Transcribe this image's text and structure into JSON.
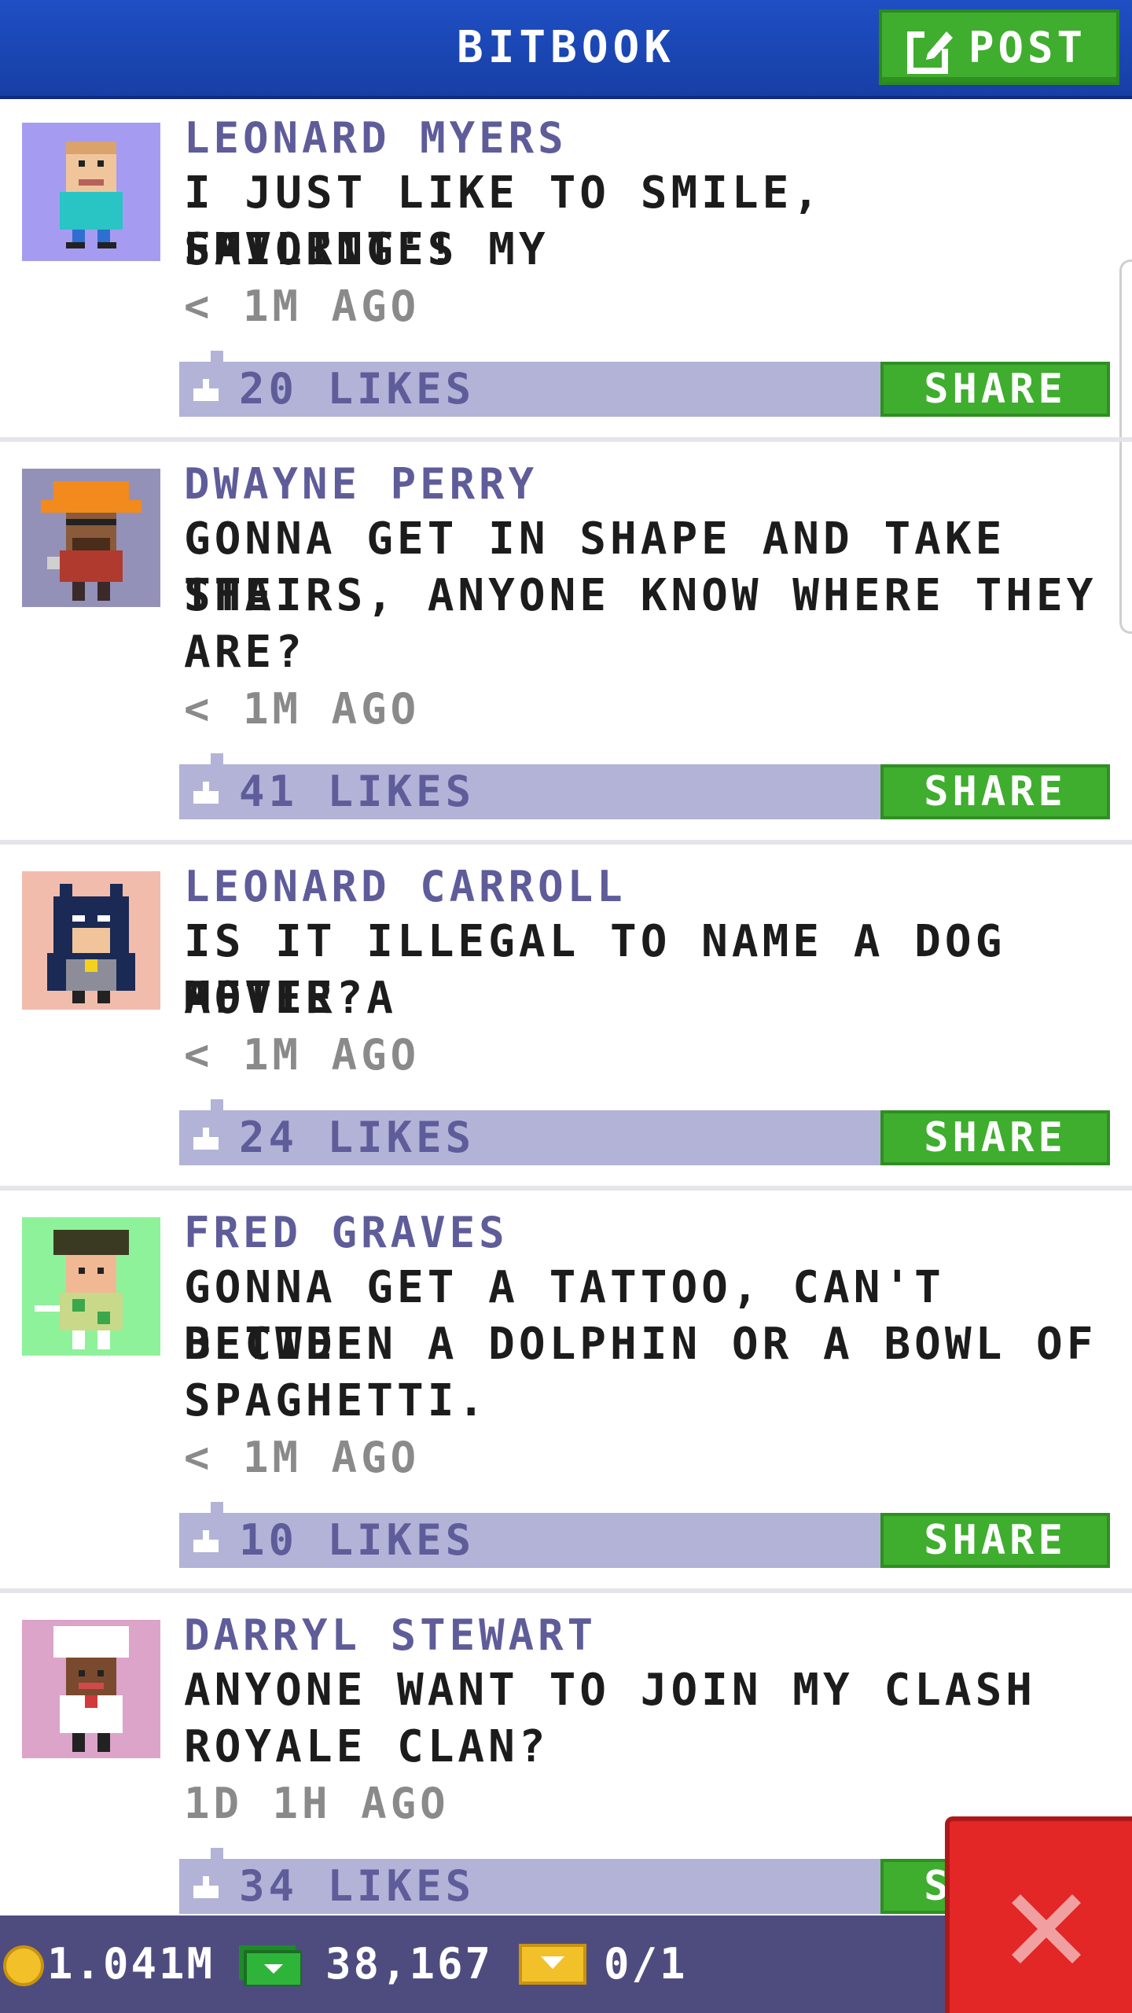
{
  "header": {
    "title": "BITBOOK",
    "post_label": "POST"
  },
  "colors": {
    "header_blue": "#1f4fc4",
    "action_green": "#3fad2e",
    "like_bar": "#b3b3d8",
    "name_purple": "#5f5c9a",
    "close_red": "#e32626"
  },
  "posts": [
    {
      "name": "LEONARD MYERS",
      "text_lines": [
        "I JUST LIKE TO SMILE, SMILING'S MY",
        "FAVORITE!"
      ],
      "time": "< 1M AGO",
      "likes": "20 LIKES",
      "share_label": "SHARE",
      "avatar_bg": "#a59cf2"
    },
    {
      "name": "DWAYNE PERRY",
      "text_lines": [
        "GONNA GET IN SHAPE AND TAKE THE",
        "STAIRS, ANYONE KNOW WHERE THEY",
        "ARE?"
      ],
      "time": "< 1M AGO",
      "likes": "41 LIKES",
      "share_label": "SHARE",
      "avatar_bg": "#9491b8"
    },
    {
      "name": "LEONARD CARROLL",
      "text_lines": [
        "IS IT ILLEGAL TO NAME A DOG AFTER A",
        "MOVIE?"
      ],
      "time": "< 1M AGO",
      "likes": "24 LIKES",
      "share_label": "SHARE",
      "avatar_bg": "#f2bcad"
    },
    {
      "name": "FRED GRAVES",
      "text_lines": [
        "GONNA GET A TATTOO, CAN'T DECIDE",
        "BETWEEN A DOLPHIN OR A BOWL OF",
        "SPAGHETTI."
      ],
      "time": "< 1M AGO",
      "likes": "10 LIKES",
      "share_label": "SHARE",
      "avatar_bg": "#8ef29a"
    },
    {
      "name": "DARRYL STEWART",
      "text_lines": [
        "ANYONE WANT TO JOIN MY CLASH",
        "ROYALE CLAN?"
      ],
      "time": "1D 1H AGO",
      "likes": "34 LIKES",
      "share_label": "SHARE",
      "avatar_bg": "#dba4c8"
    }
  ],
  "status_bar": {
    "coins": "1.041M",
    "bux": "38,167",
    "tickets": "0/1"
  }
}
